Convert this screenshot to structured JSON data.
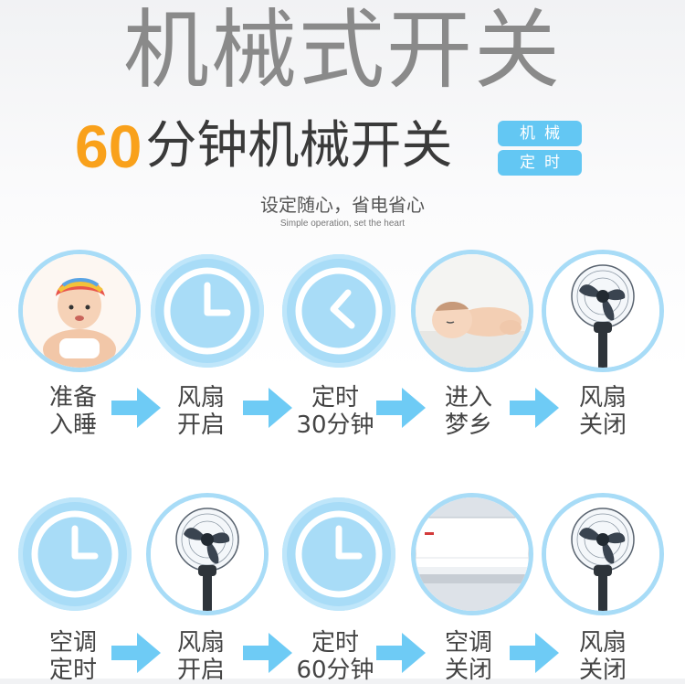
{
  "header": {
    "title": "机械式开关",
    "sub_number": "60",
    "sub_text": "分钟机械开关",
    "tags": [
      "机械",
      "定时"
    ],
    "slogan_cn": "设定随心，省电省心",
    "slogan_en": "Simple operation, set the heart"
  },
  "row1": {
    "steps": [
      {
        "icon": "baby-photo",
        "line1": "准备",
        "line2": "入睡"
      },
      {
        "icon": "clock-icon",
        "line1": "风扇",
        "line2": "开启"
      },
      {
        "icon": "clock-30-icon",
        "line1": "定时",
        "line2": "30分钟"
      },
      {
        "icon": "sleeping-baby-photo",
        "line1": "进入",
        "line2": "梦乡"
      },
      {
        "icon": "fan-icon",
        "line1": "风扇",
        "line2": "关闭"
      }
    ]
  },
  "row2": {
    "steps": [
      {
        "icon": "clock-icon",
        "line1": "空调",
        "line2": "定时"
      },
      {
        "icon": "fan-icon",
        "line1": "风扇",
        "line2": "开启"
      },
      {
        "icon": "clock-60-icon",
        "line1": "定时",
        "line2": "60分钟"
      },
      {
        "icon": "air-conditioner-photo",
        "line1": "空调",
        "line2": "关闭"
      },
      {
        "icon": "fan-icon",
        "line1": "风扇",
        "line2": "关闭"
      }
    ]
  },
  "colors": {
    "accent_blue": "#63c7f3",
    "circle_blue": "#a8dcf7",
    "arrow_blue": "#6ecbf5",
    "orange": "#f9a11b",
    "title_gray": "#8a8a8a"
  }
}
